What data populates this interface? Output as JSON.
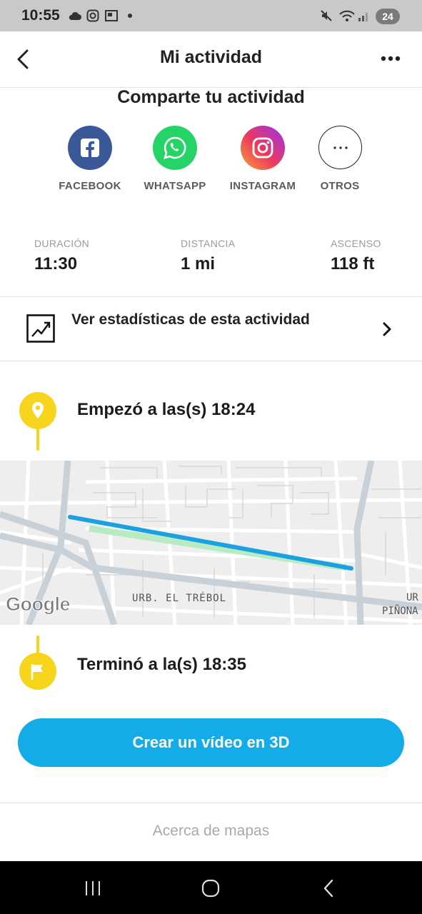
{
  "status_bar": {
    "time": "10:55",
    "battery": "24"
  },
  "header": {
    "title": "Mi actividad"
  },
  "share": {
    "title": "Comparte tu actividad",
    "items": [
      {
        "label": "FACEBOOK",
        "icon": "facebook-icon",
        "color": "#3b5998"
      },
      {
        "label": "WHATSAPP",
        "icon": "whatsapp-icon",
        "color": "#25d366"
      },
      {
        "label": "INSTAGRAM",
        "icon": "instagram-icon",
        "color": "#e1306c"
      },
      {
        "label": "OTROS",
        "icon": "more-options-icon",
        "color": "#ffffff"
      }
    ]
  },
  "stats": [
    {
      "label": "DURACIÓN",
      "value": "11:30"
    },
    {
      "label": "DISTANCIA",
      "value": "1 mi"
    },
    {
      "label": "ASCENSO",
      "value": "118 ft"
    }
  ],
  "stats_link": {
    "label": "Ver estadísticas de esta actividad"
  },
  "start": {
    "text": "Empezó a las(s) 18:24",
    "color": "#f7d51d"
  },
  "map": {
    "labels": [
      "URB. EL TRÉBOL",
      "UR",
      "PIÑONA"
    ],
    "attribution": "Google",
    "route_color": "#1ba1e2"
  },
  "end": {
    "text": "Terminó a la(s) 18:35"
  },
  "cta": {
    "label": "Crear un vídeo en 3D",
    "color": "#13ace8"
  },
  "footer": {
    "about": "Acerca de mapas"
  }
}
